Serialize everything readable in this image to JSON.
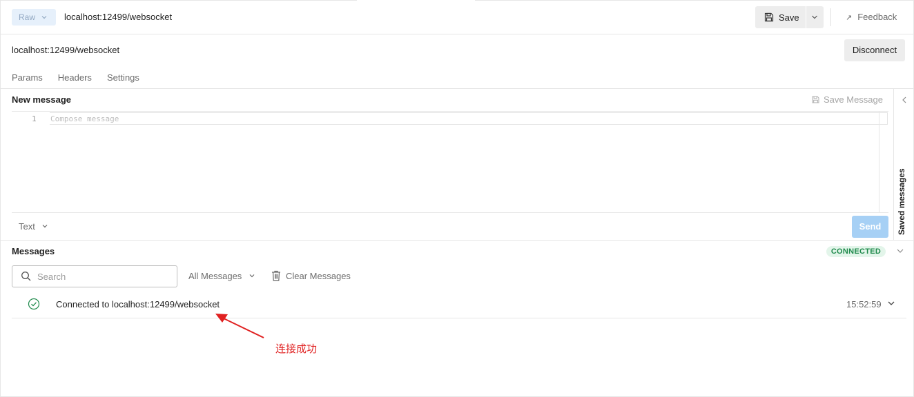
{
  "topbar": {
    "mode_label": "Raw",
    "url_title": "localhost:12499/websocket",
    "save_label": "Save",
    "feedback_label": "Feedback"
  },
  "request": {
    "url": "localhost:12499/websocket",
    "disconnect_label": "Disconnect",
    "tabs": [
      {
        "label": "Params"
      },
      {
        "label": "Headers"
      },
      {
        "label": "Settings"
      }
    ]
  },
  "composer": {
    "title": "New message",
    "save_message_label": "Save Message",
    "line_number": "1",
    "placeholder": "Compose message",
    "format_label": "Text",
    "send_label": "Send"
  },
  "side_panel": {
    "label": "Saved messages"
  },
  "messages": {
    "title": "Messages",
    "status_badge": "CONNECTED",
    "search_placeholder": "Search",
    "filter_label": "All Messages",
    "clear_label": "Clear Messages",
    "items": [
      {
        "text": "Connected to localhost:12499/websocket",
        "time": "15:52:59"
      }
    ]
  },
  "annotation": {
    "text": "连接成功",
    "color": "#e02020"
  },
  "colors": {
    "send_disabled": "#a6d0f5",
    "connected_bg": "#e3f5ea",
    "connected_text": "#1f8a4c",
    "success_icon": "#1f8a4c"
  }
}
